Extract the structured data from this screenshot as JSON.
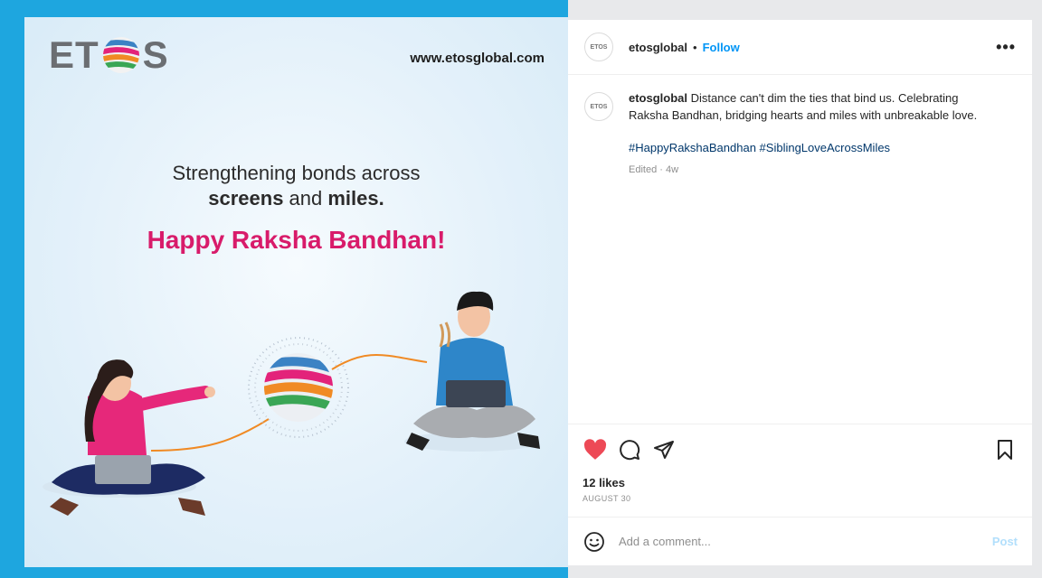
{
  "post_image": {
    "brand_letters_left": "ET",
    "brand_letters_right": "S",
    "website": "www.etosglobal.com",
    "headline_line1": "Strengthening bonds across",
    "headline_line2_a": "screens",
    "headline_line2_b": " and ",
    "headline_line2_c": "miles.",
    "greeting": "Happy Raksha Bandhan!",
    "colors": {
      "frame": "#1ea6df",
      "greeting": "#d81b6a",
      "shirt_woman": "#e6287a",
      "shirt_man": "#2e86c9"
    }
  },
  "header": {
    "avatar_text": "ETOS",
    "username": "etosglobal",
    "separator": "•",
    "follow_label": "Follow",
    "more_label": "•••"
  },
  "caption": {
    "avatar_text": "ETOS",
    "username": "etosglobal",
    "text": " Distance can't dim the ties that bind us. Celebrating Raksha Bandhan, bridging hearts and miles with unbreakable love.",
    "hashtags": "#HappyRakshaBandhan #SiblingLoveAcrossMiles",
    "meta": "Edited · 4w"
  },
  "actions": {
    "icons": [
      "heart-icon",
      "comment-icon",
      "share-icon",
      "bookmark-icon"
    ],
    "liked": true,
    "like_color": "#ed4956"
  },
  "stats": {
    "likes": "12 likes",
    "date": "AUGUST 30"
  },
  "comment_box": {
    "placeholder": "Add a comment...",
    "post_label": "Post"
  }
}
